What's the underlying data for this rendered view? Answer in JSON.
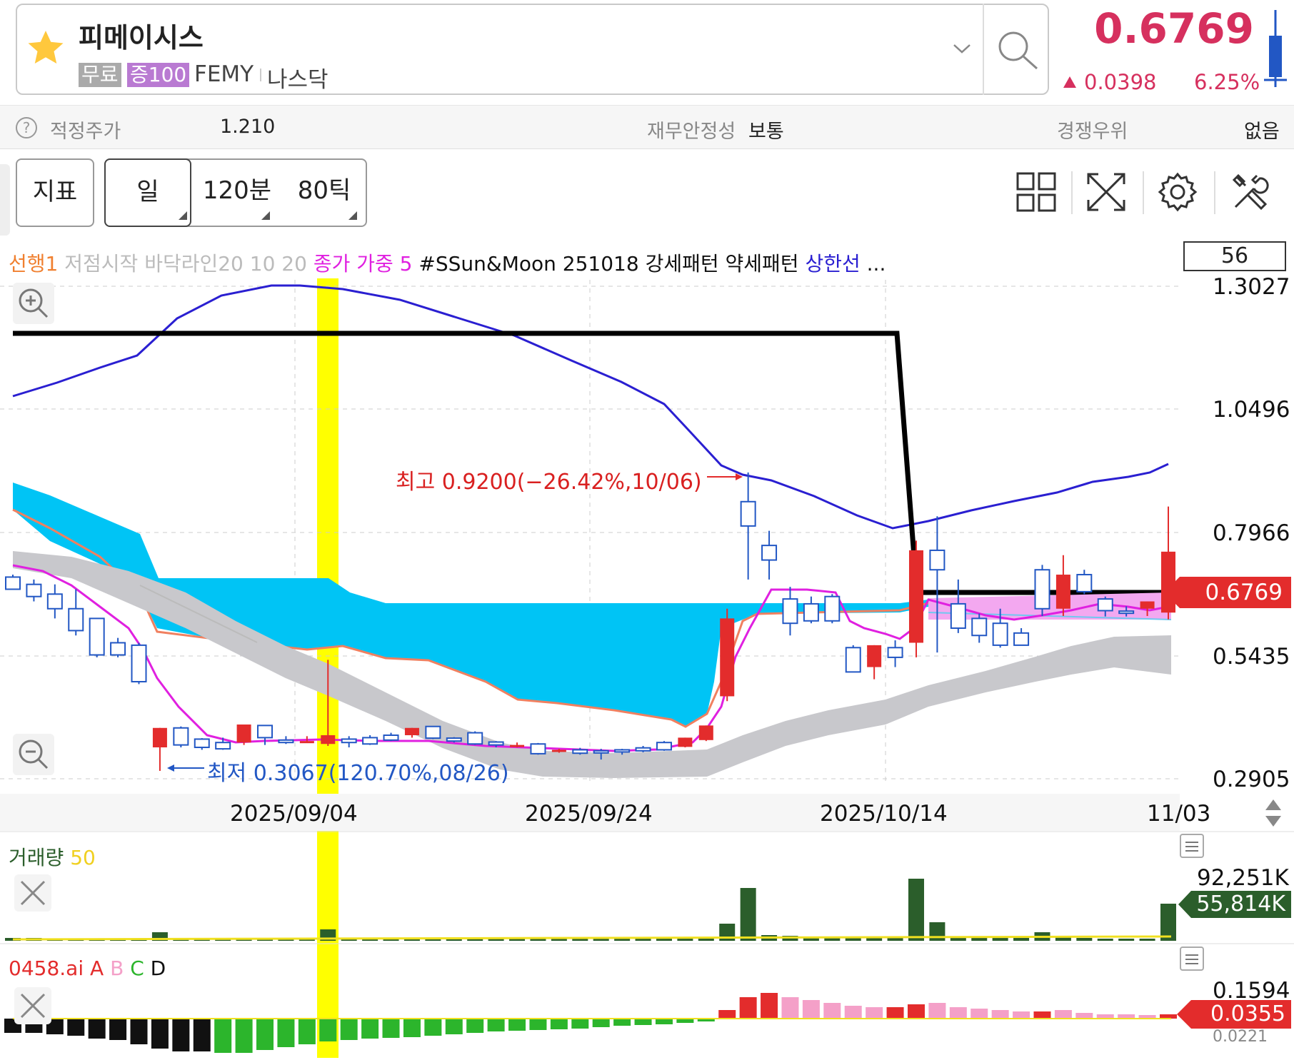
{
  "header": {
    "stock_name": "피메이시스",
    "tag_free": "무료",
    "tag_margin": "증100",
    "ticker": "FEMY",
    "market": "나스닥",
    "price": "0.6769",
    "change": "0.0398",
    "change_pct": "6.25%",
    "price_color": "#d6305e"
  },
  "info_bar": {
    "fair_price_label": "적정주가",
    "fair_price_value": "1.210",
    "stability_label": "재무안정성",
    "stability_value": "보통",
    "advantage_label": "경쟁우위",
    "advantage_value": "없음"
  },
  "toolbar": {
    "indicator_label": "지표",
    "period_day": "일",
    "period_120": "120분",
    "period_80": "80틱",
    "icons": [
      "layout-grid-icon",
      "expand-icon",
      "gear-icon",
      "tools-icon"
    ]
  },
  "legend": {
    "item1": "선행1",
    "item2": "저점시작 바닥라인20 10 20",
    "item3": "종가 가중 5",
    "item4": "#SSun&Moon 251018 강세패턴 약세패턴",
    "item5": "상한선",
    "more": "..."
  },
  "chart": {
    "count_box": "56",
    "y_labels": [
      "1.3027",
      "1.0496",
      "0.7966",
      "0.5435",
      "0.2905"
    ],
    "x_labels": [
      "2025/09/04",
      "2025/09/24",
      "2025/10/14",
      "11/03"
    ],
    "current_price_tag": "0.6769",
    "high_annotation": "최고 0.9200(−26.42%,10/06)",
    "low_annotation": "최저 0.3067(120.70%,08/26)",
    "colors": {
      "up": "#e32c2c",
      "down": "#2257c4",
      "cloud": "#00c4f5",
      "band": "#c8c8cc",
      "line_upper": "#2a1fd1",
      "line_black": "#000000",
      "ma": "#e020e0",
      "highlight": "#ffff00"
    }
  },
  "chart_data": {
    "type": "candlestick",
    "ylim": [
      0.2905,
      1.3027
    ],
    "candles": [
      {
        "o": 0.705,
        "h": 0.71,
        "c": 0.68,
        "l": 0.68
      },
      {
        "o": 0.69,
        "h": 0.7,
        "c": 0.665,
        "l": 0.655
      },
      {
        "o": 0.67,
        "h": 0.69,
        "c": 0.64,
        "l": 0.62
      },
      {
        "o": 0.64,
        "h": 0.68,
        "c": 0.595,
        "l": 0.585
      },
      {
        "o": 0.62,
        "h": 0.62,
        "c": 0.545,
        "l": 0.54
      },
      {
        "o": 0.57,
        "h": 0.58,
        "c": 0.545,
        "l": 0.54
      },
      {
        "o": 0.565,
        "h": 0.57,
        "c": 0.49,
        "l": 0.485
      },
      {
        "o": 0.355,
        "h": 0.372,
        "c": 0.395,
        "l": 0.3067
      },
      {
        "o": 0.395,
        "h": 0.398,
        "c": 0.36,
        "l": 0.355
      },
      {
        "o": 0.372,
        "h": 0.374,
        "c": 0.355,
        "l": 0.35
      },
      {
        "o": 0.365,
        "h": 0.375,
        "c": 0.352,
        "l": 0.35
      },
      {
        "o": 0.365,
        "h": 0.4,
        "c": 0.402,
        "l": 0.36
      },
      {
        "o": 0.4,
        "h": 0.4,
        "c": 0.375,
        "l": 0.36
      },
      {
        "o": 0.37,
        "h": 0.378,
        "c": 0.365,
        "l": 0.362
      },
      {
        "o": 0.368,
        "h": 0.378,
        "c": 0.368,
        "l": 0.364
      },
      {
        "o": 0.362,
        "h": 0.535,
        "c": 0.38,
        "l": 0.358
      },
      {
        "o": 0.372,
        "h": 0.378,
        "c": 0.365,
        "l": 0.355
      },
      {
        "o": 0.375,
        "h": 0.38,
        "c": 0.362,
        "l": 0.36
      },
      {
        "o": 0.38,
        "h": 0.385,
        "c": 0.37,
        "l": 0.368
      },
      {
        "o": 0.38,
        "h": 0.395,
        "c": 0.395,
        "l": 0.375
      },
      {
        "o": 0.398,
        "h": 0.398,
        "c": 0.374,
        "l": 0.372
      },
      {
        "o": 0.374,
        "h": 0.376,
        "c": 0.368,
        "l": 0.365
      },
      {
        "o": 0.385,
        "h": 0.388,
        "c": 0.362,
        "l": 0.36
      },
      {
        "o": 0.366,
        "h": 0.368,
        "c": 0.36,
        "l": 0.355
      },
      {
        "o": 0.36,
        "h": 0.365,
        "c": 0.36,
        "l": 0.355
      },
      {
        "o": 0.362,
        "h": 0.364,
        "c": 0.342,
        "l": 0.34
      },
      {
        "o": 0.35,
        "h": 0.352,
        "c": 0.35,
        "l": 0.344
      },
      {
        "o": 0.35,
        "h": 0.354,
        "c": 0.343,
        "l": 0.34
      },
      {
        "o": 0.348,
        "h": 0.352,
        "c": 0.346,
        "l": 0.33
      },
      {
        "o": 0.35,
        "h": 0.352,
        "c": 0.346,
        "l": 0.34
      },
      {
        "o": 0.354,
        "h": 0.358,
        "c": 0.348,
        "l": 0.345
      },
      {
        "o": 0.365,
        "h": 0.368,
        "c": 0.35,
        "l": 0.348
      },
      {
        "o": 0.356,
        "h": 0.365,
        "c": 0.375,
        "l": 0.355
      },
      {
        "o": 0.37,
        "h": 0.4,
        "c": 0.4,
        "l": 0.368
      },
      {
        "o": 0.46,
        "h": 0.64,
        "c": 0.62,
        "l": 0.45
      },
      {
        "o": 0.86,
        "h": 0.92,
        "c": 0.81,
        "l": 0.7
      },
      {
        "o": 0.77,
        "h": 0.8,
        "c": 0.74,
        "l": 0.7
      },
      {
        "o": 0.66,
        "h": 0.685,
        "c": 0.61,
        "l": 0.585
      },
      {
        "o": 0.65,
        "h": 0.665,
        "c": 0.615,
        "l": 0.61
      },
      {
        "o": 0.665,
        "h": 0.67,
        "c": 0.615,
        "l": 0.61
      },
      {
        "o": 0.56,
        "h": 0.565,
        "c": 0.51,
        "l": 0.51
      },
      {
        "o": 0.52,
        "h": 0.565,
        "c": 0.565,
        "l": 0.495
      },
      {
        "o": 0.56,
        "h": 0.575,
        "c": 0.54,
        "l": 0.52
      },
      {
        "o": 0.57,
        "h": 0.78,
        "c": 0.76,
        "l": 0.54
      },
      {
        "o": 0.76,
        "h": 0.83,
        "c": 0.72,
        "l": 0.55
      },
      {
        "o": 0.65,
        "h": 0.7,
        "c": 0.6,
        "l": 0.59
      },
      {
        "o": 0.62,
        "h": 0.63,
        "c": 0.585,
        "l": 0.57
      },
      {
        "o": 0.61,
        "h": 0.64,
        "c": 0.565,
        "l": 0.56
      },
      {
        "o": 0.59,
        "h": 0.6,
        "c": 0.565,
        "l": 0.565
      },
      {
        "o": 0.72,
        "h": 0.73,
        "c": 0.64,
        "l": 0.625
      },
      {
        "o": 0.64,
        "h": 0.75,
        "c": 0.71,
        "l": 0.625
      },
      {
        "o": 0.71,
        "h": 0.72,
        "c": 0.675,
        "l": 0.67
      },
      {
        "o": 0.66,
        "h": 0.665,
        "c": 0.636,
        "l": 0.624
      },
      {
        "o": 0.635,
        "h": 0.645,
        "c": 0.632,
        "l": 0.624
      },
      {
        "o": 0.64,
        "h": 0.655,
        "c": 0.655,
        "l": 0.625
      },
      {
        "o": 0.632,
        "h": 0.85,
        "c": 0.7572,
        "l": 0.618
      }
    ],
    "volume": {
      "label": "거래량",
      "period": "50",
      "max_label": "92,251K",
      "current_label": "55,814K"
    },
    "ai_panel": {
      "label": "0458.ai",
      "series_labels": [
        "A",
        "B",
        "C",
        "D"
      ],
      "max_label": "0.1594",
      "current_label": "0.0355",
      "min_label": "0.0221"
    }
  }
}
